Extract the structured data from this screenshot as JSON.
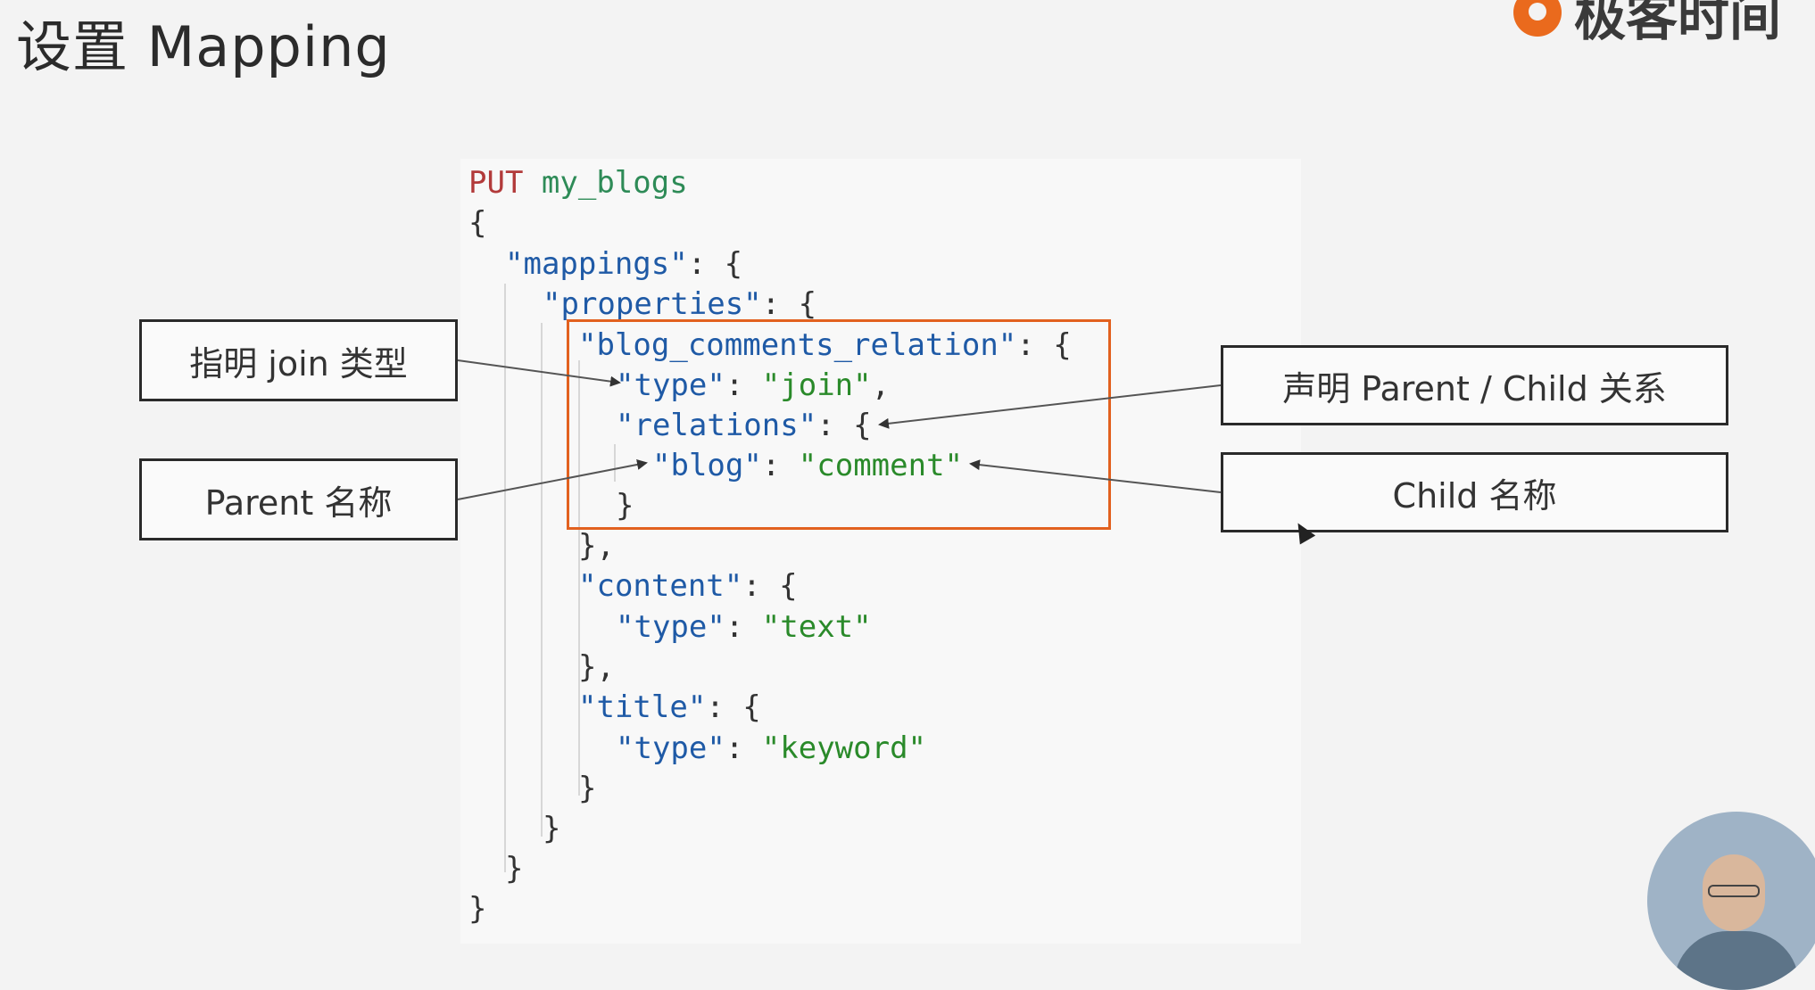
{
  "header": {
    "title": "设置 Mapping",
    "logo_text": "极客时间"
  },
  "code": {
    "line1_verb": "PUT",
    "line1_path": "my_blogs",
    "line2": "{",
    "line3_key": "\"mappings\"",
    "line3_punc": ": {",
    "line4_key": "\"properties\"",
    "line4_punc": ": {",
    "line5_key": "\"blog_comments_relation\"",
    "line5_punc": ": {",
    "line6_key": "\"type\"",
    "line6_punc": ": ",
    "line6_val": "\"join\"",
    "line6_end": ",",
    "line7_key": "\"relations\"",
    "line7_punc": ": {",
    "line8_key": "\"blog\"",
    "line8_punc": ": ",
    "line8_val": "\"comment\"",
    "line9": "}",
    "line10": "},",
    "line11_key": "\"content\"",
    "line11_punc": ": {",
    "line12_key": "\"type\"",
    "line12_punc": ": ",
    "line12_val": "\"text\"",
    "line13": "},",
    "line14_key": "\"title\"",
    "line14_punc": ": {",
    "line15_key": "\"type\"",
    "line15_punc": ": ",
    "line15_val": "\"keyword\"",
    "line16": "}",
    "line17": "}",
    "line18": "}",
    "line19": "}"
  },
  "callouts": {
    "join_type": "指明 join 类型",
    "parent_name": "Parent 名称",
    "relation_decl": "声明 Parent / Child 关系",
    "child_name": "Child 名称"
  },
  "colors": {
    "highlight_border": "#e2611f",
    "logo_orange": "#ea6a1d",
    "json_key": "#1f5aa6",
    "json_string": "#2a8a2a",
    "http_verb": "#b23a3a"
  }
}
